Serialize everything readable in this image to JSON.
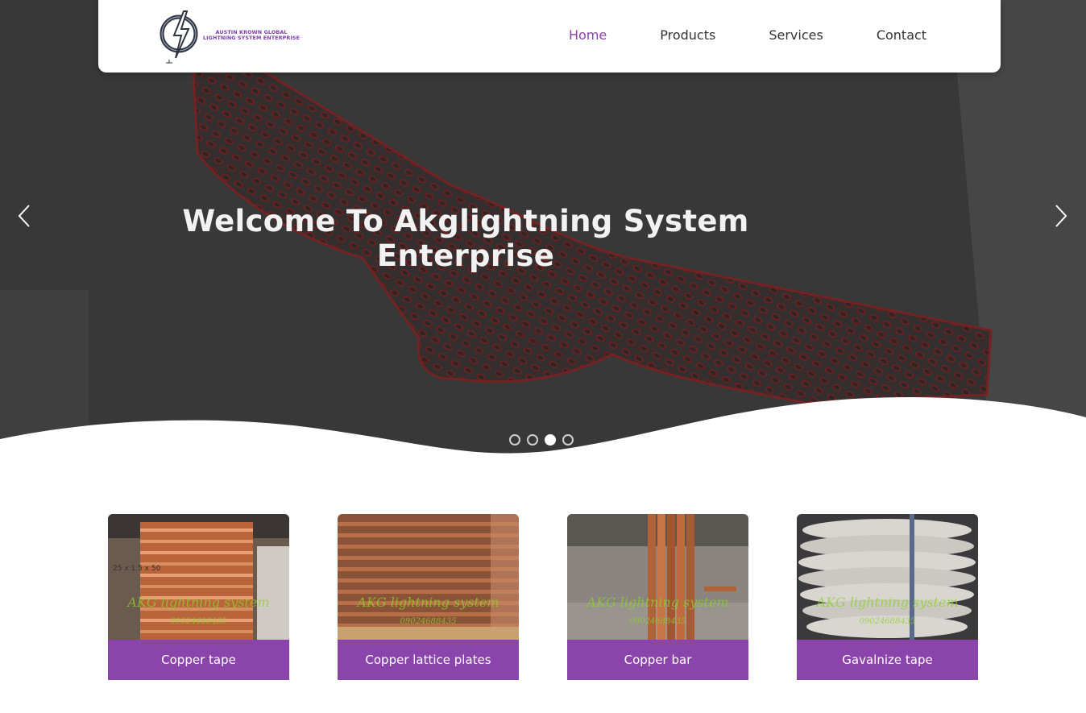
{
  "header": {
    "logo_line1": "AUSTIN KROWN GLOBAL",
    "logo_line2": "LIGHTNING SYSTEM ENTERPRISE",
    "nav": {
      "home": "Home",
      "products": "Products",
      "services": "Services",
      "contact": "Contact"
    },
    "active_nav": "Home",
    "accent_color": "#8b3fa5"
  },
  "hero": {
    "title": "Welcome To Akglightning System Enterprise",
    "slide_count": 4,
    "active_slide": 3,
    "prev_icon": "chevron-left-icon",
    "next_icon": "chevron-right-icon"
  },
  "products": [
    {
      "caption": "Copper tape",
      "watermark": "AKG lightning system",
      "phone": "09024688435",
      "size_label": "25 x 1.5 x 50"
    },
    {
      "caption": "Copper lattice plates",
      "watermark": "AKG lightning system",
      "phone": "09024688435"
    },
    {
      "caption": "Copper bar",
      "watermark": "AKG lightning system",
      "phone": "09024688435"
    },
    {
      "caption": "Gavalnize tape",
      "watermark": "AKG lightning system",
      "phone": "09024688435"
    }
  ],
  "colors": {
    "card_caption_bg": "#8c44ad",
    "hero_overlay": "#3d3d3e"
  }
}
